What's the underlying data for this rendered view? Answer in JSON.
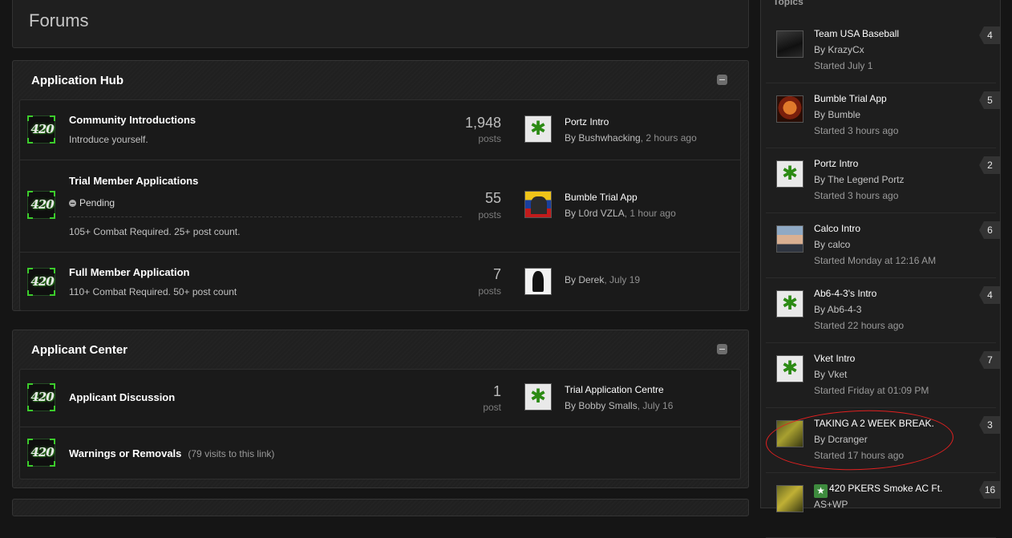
{
  "page": {
    "title": "Forums"
  },
  "sections": [
    {
      "title": "Application Hub",
      "forums": [
        {
          "name": "Community Introductions",
          "description": "Introduce yourself.",
          "count": "1,948",
          "count_label": "posts",
          "last_title": "Portz Intro",
          "last_by_prefix": "By ",
          "last_author": "Bushwhacking",
          "last_time": ", 2 hours ago",
          "icon_text": "420"
        },
        {
          "name": "Trial Member Applications",
          "status": "Pending",
          "description": "105+ Combat Required. 25+ post count.",
          "count": "55",
          "count_label": "posts",
          "last_title": "Bumble Trial App",
          "last_by_prefix": "By ",
          "last_author": "L0rd VZLA",
          "last_time": ", 1 hour ago",
          "icon_text": "420"
        },
        {
          "name": "Full Member Application",
          "description": "110+ Combat Required. 50+ post count",
          "count": "7",
          "count_label": "posts",
          "last_by_prefix": "By ",
          "last_author": "Derek",
          "last_time": ", July 19",
          "icon_text": "420"
        }
      ]
    },
    {
      "title": "Applicant Center",
      "forums": [
        {
          "name": "Applicant Discussion",
          "count": "1",
          "count_label": "post",
          "last_title": "Trial Application Centre",
          "last_by_prefix": "By ",
          "last_author": "Bobby Smalls",
          "last_time": ", July 16",
          "icon_text": "420"
        },
        {
          "name": "Warnings or Removals",
          "visits": "(79 visits to this link)",
          "icon_text": "420"
        }
      ]
    }
  ],
  "sidebar": {
    "title": "Topics",
    "topics": [
      {
        "title": "Team USA Baseball",
        "by": "By KrazyCx",
        "started": "Started July 1",
        "count": "4"
      },
      {
        "title": "Bumble Trial App",
        "by": "By Bumble",
        "started": "Started 3 hours ago",
        "count": "5"
      },
      {
        "title": "Portz Intro",
        "by": "By The Legend Portz",
        "started": "Started 3 hours ago",
        "count": "2"
      },
      {
        "title": "Calco Intro",
        "by": "By calco",
        "started": "Started Monday at 12:16 AM",
        "count": "6"
      },
      {
        "title": "Ab6-4-3's Intro",
        "by": "By Ab6-4-3",
        "started": "Started 22 hours ago",
        "count": "4"
      },
      {
        "title": "Vket Intro",
        "by": "By Vket",
        "started": "Started Friday at 01:09 PM",
        "count": "7"
      },
      {
        "title": "TAKING A 2 WEEK BREAK.",
        "by": "By Dcranger",
        "started": "Started 17 hours ago",
        "count": "3"
      },
      {
        "title": "420 PKERS Smoke AC Ft.",
        "by": "AS+WP",
        "started": "",
        "count": "16"
      }
    ]
  },
  "colors": {
    "annotation_circle": "#e02020",
    "pinned_badge": "#3e8b3e"
  }
}
